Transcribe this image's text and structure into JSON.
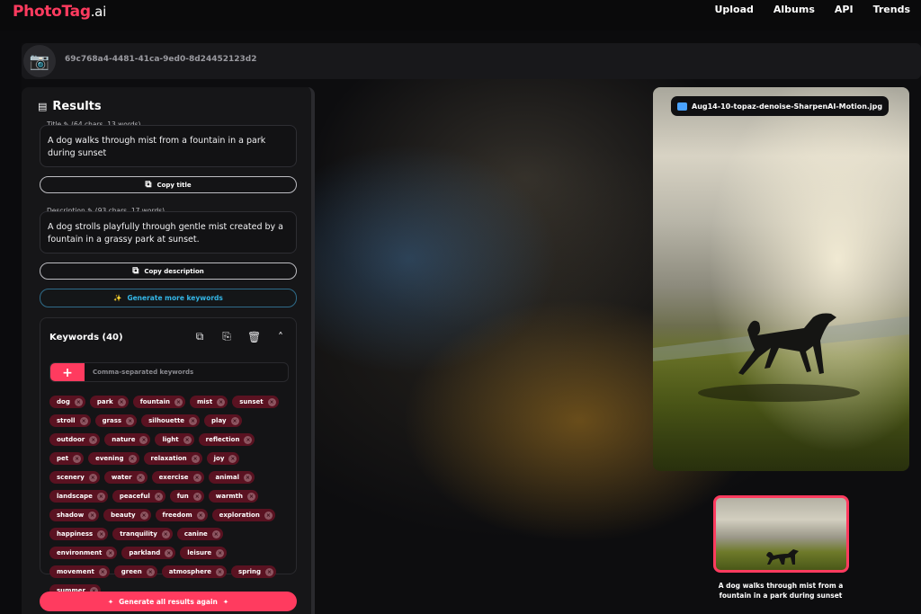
{
  "nav": {
    "logo_main": "PhotoTag",
    "logo_suffix": ".ai",
    "links": [
      "Upload",
      "Albums",
      "API",
      "Trends"
    ]
  },
  "header": {
    "camera_icon": "camera-icon",
    "doc_id": "69c768a4-4481-41ca-9ed0-8d24452123d2"
  },
  "results": {
    "heading": "Results",
    "title_label": "Title ✎ (64 chars, 13 words)",
    "title_value": "A dog walks through mist from a fountain in a park during sunset",
    "copy_title": "Copy title",
    "description_label": "Description ✎ (93 chars, 17 words)",
    "description_value": "A dog strolls playfully through gentle mist created by a fountain in a grassy park at sunset.",
    "copy_description": "Copy description",
    "generate_more": "Generate more keywords",
    "keywords_heading": "Keywords (40)",
    "keywords_placeholder": "Comma-separated keywords",
    "keywords": [
      "dog",
      "park",
      "fountain",
      "mist",
      "sunset",
      "stroll",
      "grass",
      "silhouette",
      "play",
      "outdoor",
      "nature",
      "light",
      "reflection",
      "pet",
      "evening",
      "relaxation",
      "joy",
      "scenery",
      "water",
      "exercise",
      "animal",
      "landscape",
      "peaceful",
      "fun",
      "warmth",
      "shadow",
      "beauty",
      "freedom",
      "exploration",
      "happiness",
      "tranquility",
      "canine",
      "environment",
      "parkland",
      "leisure",
      "movement",
      "green",
      "atmosphere",
      "spring",
      "summer"
    ],
    "generate_all": "Generate all results again"
  },
  "image": {
    "filename": "Aug14-10-topaz-denoise-SharpenAI-Motion.jpg",
    "thumb_caption": "A dog walks through mist from a fountain in a park during sunset"
  },
  "colors": {
    "accent": "#ff3b5f",
    "tag_bg": "#5a1221",
    "link_blue": "#34b6e6"
  }
}
